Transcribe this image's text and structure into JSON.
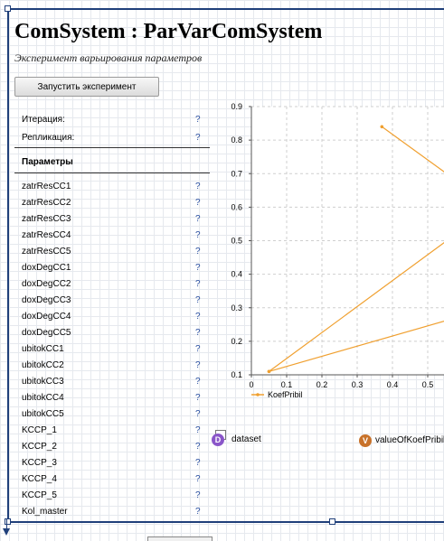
{
  "header": {
    "title": "ComSystem : ParVarComSystem",
    "subtitle": "Эксперимент варьирования параметров"
  },
  "run_button": {
    "label": "Запустить эксперимент"
  },
  "status_rows": [
    {
      "label": "Итерация:",
      "value": "?"
    },
    {
      "label": "Репликация:",
      "value": "?"
    }
  ],
  "params": {
    "heading": "Параметры",
    "items": [
      {
        "label": "zatrResCC1",
        "value": "?"
      },
      {
        "label": "zatrResCC2",
        "value": "?"
      },
      {
        "label": "zatrResCC3",
        "value": "?"
      },
      {
        "label": "zatrResCC4",
        "value": "?"
      },
      {
        "label": "zatrResCC5",
        "value": "?"
      },
      {
        "label": "doxDegCC1",
        "value": "?"
      },
      {
        "label": "doxDegCC2",
        "value": "?"
      },
      {
        "label": "doxDegCC3",
        "value": "?"
      },
      {
        "label": "doxDegCC4",
        "value": "?"
      },
      {
        "label": "doxDegCC5",
        "value": "?"
      },
      {
        "label": "ubitokCC1",
        "value": "?"
      },
      {
        "label": "ubitokCC2",
        "value": "?"
      },
      {
        "label": "ubitokCC3",
        "value": "?"
      },
      {
        "label": "ubitokCC4",
        "value": "?"
      },
      {
        "label": "ubitokCC5",
        "value": "?"
      },
      {
        "label": "KCCP_1",
        "value": "?"
      },
      {
        "label": "KCCP_2",
        "value": "?"
      },
      {
        "label": "KCCP_3",
        "value": "?"
      },
      {
        "label": "KCCP_4",
        "value": "?"
      },
      {
        "label": "KCCP_5",
        "value": "?"
      },
      {
        "label": "Kol_master",
        "value": "?"
      }
    ]
  },
  "chart_data": {
    "type": "line",
    "title": "",
    "xlabel": "",
    "ylabel": "",
    "xlim": [
      0,
      0.58
    ],
    "ylim": [
      0.1,
      0.9
    ],
    "x_ticks": [
      "0",
      "0.1",
      "0.2",
      "0.3",
      "0.4",
      "0.5"
    ],
    "y_ticks": [
      "0.1",
      "0.2",
      "0.3",
      "0.4",
      "0.5",
      "0.6",
      "0.7",
      "0.8",
      "0.9"
    ],
    "grid": true,
    "legend_position": "bottom-left",
    "series": [
      {
        "name": "KoefPribil",
        "color": "#f0a030",
        "segments": [
          [
            [
              0.05,
              0.11
            ],
            [
              0.58,
              0.52
            ]
          ],
          [
            [
              0.05,
              0.11
            ],
            [
              0.58,
              0.27
            ]
          ],
          [
            [
              0.37,
              0.84
            ],
            [
              0.58,
              0.68
            ]
          ]
        ]
      }
    ]
  },
  "dataset": {
    "icon": "dataset-d-icon",
    "icon_letter": "D",
    "label": "dataset"
  },
  "value_var": {
    "icon": "variable-v-icon",
    "icon_letter": "V",
    "label": "valueOfKoefPribil"
  }
}
